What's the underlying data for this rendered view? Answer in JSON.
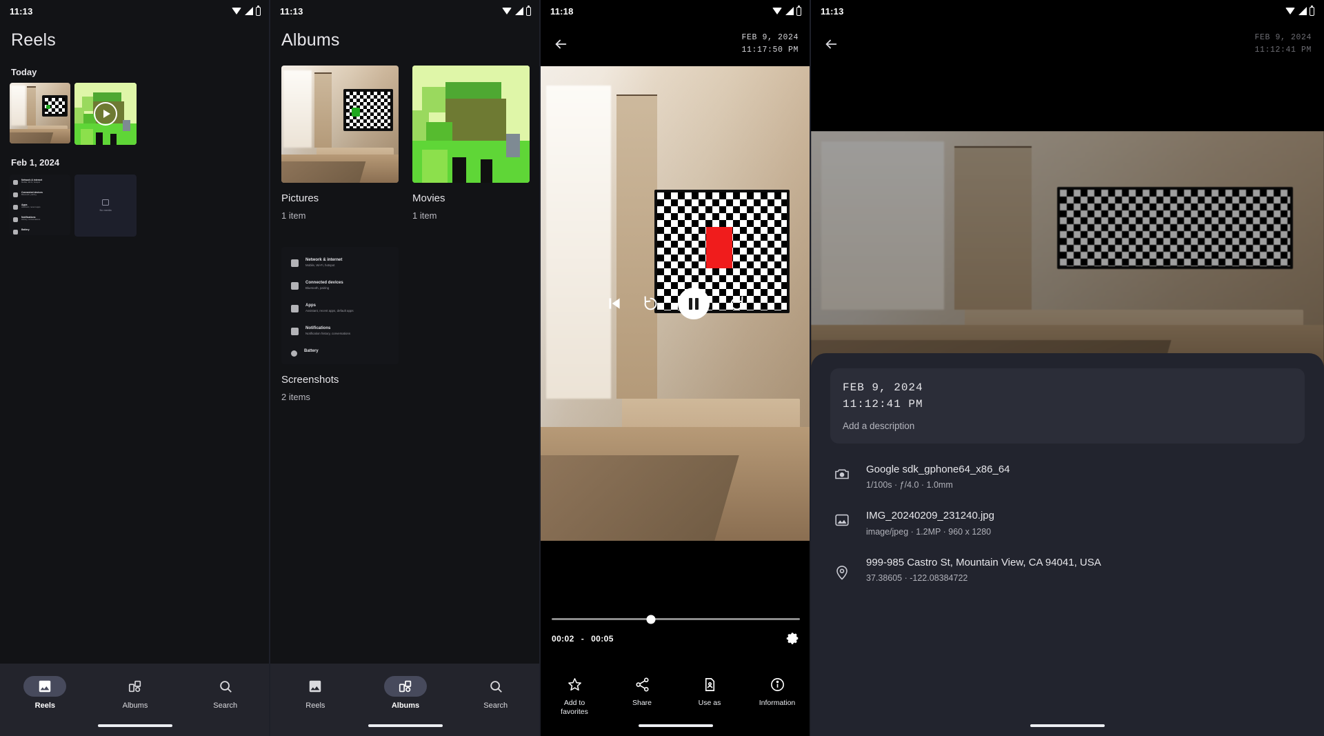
{
  "panels": {
    "reels": {
      "status": {
        "time": "11:13",
        "icons": [
          "wifi-icon",
          "signal-icon",
          "battery-icon"
        ]
      },
      "title": "Reels",
      "section_today": "Today",
      "section_date": "Feb 1, 2024",
      "thumbs": [
        {
          "name": "room-photo-thumb",
          "kind": "photo"
        },
        {
          "name": "green-video-thumb",
          "kind": "video",
          "has_play": true
        }
      ],
      "older_thumbs": [
        {
          "name": "settings-screenshot-thumb",
          "kind": "screenshot"
        },
        {
          "name": "note-screenshot-thumb",
          "kind": "screenshot"
        }
      ],
      "nav": [
        {
          "label": "Reels",
          "icon": "photo-icon",
          "active": true
        },
        {
          "label": "Albums",
          "icon": "albums-icon",
          "active": false
        },
        {
          "label": "Search",
          "icon": "search-icon",
          "active": false
        }
      ]
    },
    "albums": {
      "status": {
        "time": "11:13"
      },
      "title": "Albums",
      "items": [
        {
          "name": "Pictures",
          "count": "1 item",
          "thumb": "room-photo"
        },
        {
          "name": "Movies",
          "count": "1 item",
          "thumb": "green-video"
        },
        {
          "name": "Screenshots",
          "count": "2 items",
          "thumb": "settings-screenshot"
        }
      ],
      "screenshot_rows": [
        {
          "title": "Network & internet",
          "sub": "Mobile, Wi-Fi, hotspot"
        },
        {
          "title": "Connected devices",
          "sub": "Bluetooth, pairing"
        },
        {
          "title": "Apps",
          "sub": "Assistant, recent apps, default apps"
        },
        {
          "title": "Notifications",
          "sub": "Notification history, conversations"
        },
        {
          "title": "Battery",
          "sub": ""
        }
      ],
      "nav": [
        {
          "label": "Reels",
          "icon": "photo-icon",
          "active": false
        },
        {
          "label": "Albums",
          "icon": "albums-icon",
          "active": true
        },
        {
          "label": "Search",
          "icon": "search-icon",
          "active": false
        }
      ]
    },
    "player": {
      "status": {
        "time": "11:18"
      },
      "back_icon": "back-arrow-icon",
      "date": "FEB 9, 2024",
      "time": "11:17:50 PM",
      "controls": {
        "prev": "skip-previous-icon",
        "rewind": "replay-10-icon",
        "pause": "pause-icon",
        "forward": "forward-10-icon"
      },
      "position": "00:02",
      "separator": "-",
      "duration": "00:05",
      "settings_icon": "gear-icon",
      "progress_percent": 40,
      "actions": [
        {
          "label": "Add to\nfavorites",
          "icon": "star-icon"
        },
        {
          "label": "Share",
          "icon": "share-icon"
        },
        {
          "label": "Use as",
          "icon": "use-as-icon"
        },
        {
          "label": "Information",
          "icon": "info-icon"
        }
      ]
    },
    "details": {
      "status": {
        "time": "11:13"
      },
      "back_icon": "back-arrow-icon",
      "header_date": "FEB 9, 2024",
      "header_time": "11:12:41 PM",
      "sheet": {
        "date": "FEB 9, 2024",
        "time": "11:12:41 PM",
        "description_placeholder": "Add a description",
        "rows": [
          {
            "icon": "camera-icon",
            "title": "Google sdk_gphone64_x86_64",
            "sub": "1/100s · ƒ/4.0 · 1.0mm"
          },
          {
            "icon": "image-icon",
            "title": "IMG_20240209_231240.jpg",
            "sub": "image/jpeg · 1.2MP · 960 x 1280"
          },
          {
            "icon": "location-pin-icon",
            "title": "999-985 Castro St, Mountain View, CA 94041, USA",
            "sub": "37.38605 · -122.08384722"
          }
        ]
      }
    }
  },
  "colors": {
    "background": "#121316",
    "nav_bar": "#23242c",
    "active_pill": "#474a5c",
    "sheet": "#22242e",
    "card": "#2b2d38",
    "accent_green": "#1ea81e",
    "accent_red": "#f01c1c"
  }
}
